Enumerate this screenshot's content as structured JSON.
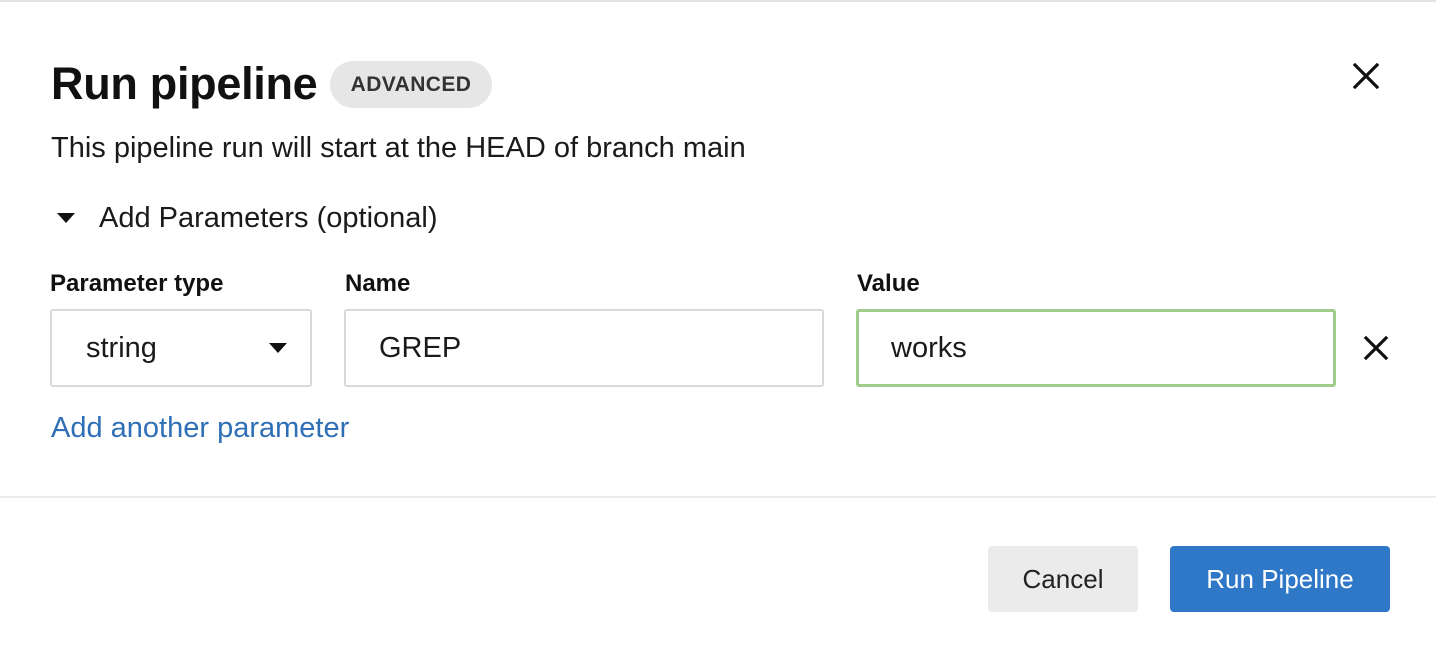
{
  "dialog": {
    "title": "Run pipeline",
    "badge": "ADVANCED",
    "subtitle": "This pipeline run will start at the HEAD of branch main"
  },
  "parameters": {
    "toggle_label": "Add Parameters (optional)",
    "expanded": true,
    "labels": {
      "type": "Parameter type",
      "name": "Name",
      "value": "Value"
    },
    "rows": [
      {
        "type": "string",
        "name": "GREP",
        "value": "works"
      }
    ],
    "add_link": "Add another parameter"
  },
  "footer": {
    "cancel_label": "Cancel",
    "run_label": "Run Pipeline"
  },
  "colors": {
    "primary": "#2f78c8",
    "link": "#2f6fb5",
    "focus_border": "#9fcc8a",
    "badge_bg": "#e6e6e6"
  }
}
